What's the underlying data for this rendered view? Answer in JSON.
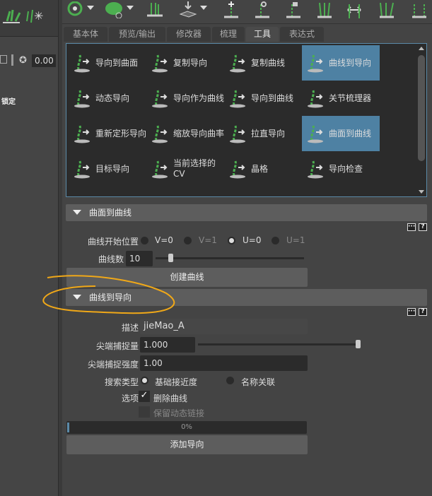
{
  "left": {
    "value": "0.00",
    "partial_label": "锁定"
  },
  "tabs": [
    {
      "label": "基本体"
    },
    {
      "label": "预览/输出"
    },
    {
      "label": "修改器"
    },
    {
      "label": "梳理"
    },
    {
      "label": "工具",
      "active": true
    },
    {
      "label": "表达式"
    }
  ],
  "tools": [
    {
      "label": "导向到曲面"
    },
    {
      "label": "复制导向"
    },
    {
      "label": "复制曲线"
    },
    {
      "label": "曲线到导向",
      "selected": true
    },
    {
      "label": "动态导向"
    },
    {
      "label": "导向作为曲线"
    },
    {
      "label": "导向到曲线"
    },
    {
      "label": "关节梳理器"
    },
    {
      "label": "重新定形导向"
    },
    {
      "label": "缩放导向曲率"
    },
    {
      "label": "拉直导向"
    },
    {
      "label": "曲面到曲线",
      "selected": true
    },
    {
      "label": "目标导向"
    },
    {
      "label": "当前选择的 CV"
    },
    {
      "label": "晶格"
    },
    {
      "label": "导向检查"
    }
  ],
  "surface_to_curves": {
    "title": "曲面到曲线",
    "start_label": "曲线开始位置",
    "options": [
      {
        "label": "V=0"
      },
      {
        "label": "V=1"
      },
      {
        "label": "U=0",
        "selected": true
      },
      {
        "label": "U=1"
      }
    ],
    "count_label": "曲线数",
    "count_value": "10",
    "count_slider_fraction": 0.09,
    "create_button": "创建曲线"
  },
  "curves_to_guides": {
    "title": "曲线到导向",
    "desc_label": "描述",
    "desc_value": "jieMao_A",
    "tip_snap_label": "尖端捕捉量",
    "tip_snap_value": "1.000",
    "tip_snap_fraction": 1.0,
    "tip_strength_label": "尖端捕捉强度",
    "tip_strength_value": "1.00",
    "search_label": "搜索类型",
    "search_options": [
      {
        "label": "基础接近度",
        "selected": true
      },
      {
        "label": "名称关联"
      }
    ],
    "options_label": "选项",
    "delete_curves": "删除曲线",
    "keep_links": "保留动态链接",
    "progress_text": "0%",
    "progress": 0,
    "add_button": "添加导向"
  },
  "colors": {
    "accent": "#4e81a3",
    "annotation": "#f0a818",
    "icon_green": "#4caf50"
  }
}
